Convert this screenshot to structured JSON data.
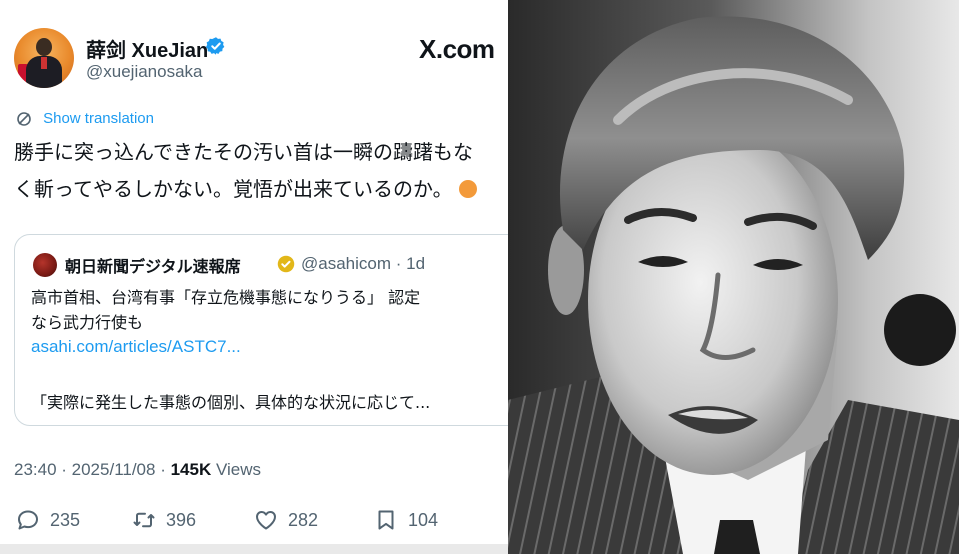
{
  "tweet": {
    "display_name": "薛剑 XueJian",
    "handle": "@xuejianosaka",
    "platform_logo": "X.com",
    "translate_label": "Show translation",
    "text_lines": [
      "勝手に突っ込んできたその汚い首は一瞬の躊躇もな",
      "く斬ってやるしかない。覚悟が出来ているのか。"
    ],
    "quote": {
      "account_name": "朝日新聞デジタル速報席",
      "meta": "@asahicom · 1d",
      "body_lines": [
        "高市首相、台湾有事「存立危機事態になりうる」 認定",
        "なら武力行使も"
      ],
      "link": "asahi.com/articles/ASTC7...",
      "excerpt": "「実際に発生した事態の個別、具体的な状況に応じて..."
    },
    "timestamp": "23:40 · 2025/11/08 · ",
    "views_count": "145K",
    "views_label": " Views",
    "actions": {
      "replies": "235",
      "reposts": "396",
      "likes": "282",
      "bookmarks": "104"
    }
  },
  "icons": {
    "verified": "verified-badge-icon",
    "globe": "globe-icon",
    "reply": "reply-icon",
    "repost": "repost-icon",
    "like": "heart-icon",
    "bookmark": "bookmark-icon"
  },
  "colors": {
    "link_blue": "#1d9bf0",
    "verified_blue": "#1d9bf0",
    "org_badge_gold": "#e2b719",
    "secondary_text": "#536471",
    "primary_text": "#0f1419",
    "border": "#cfd9de"
  }
}
